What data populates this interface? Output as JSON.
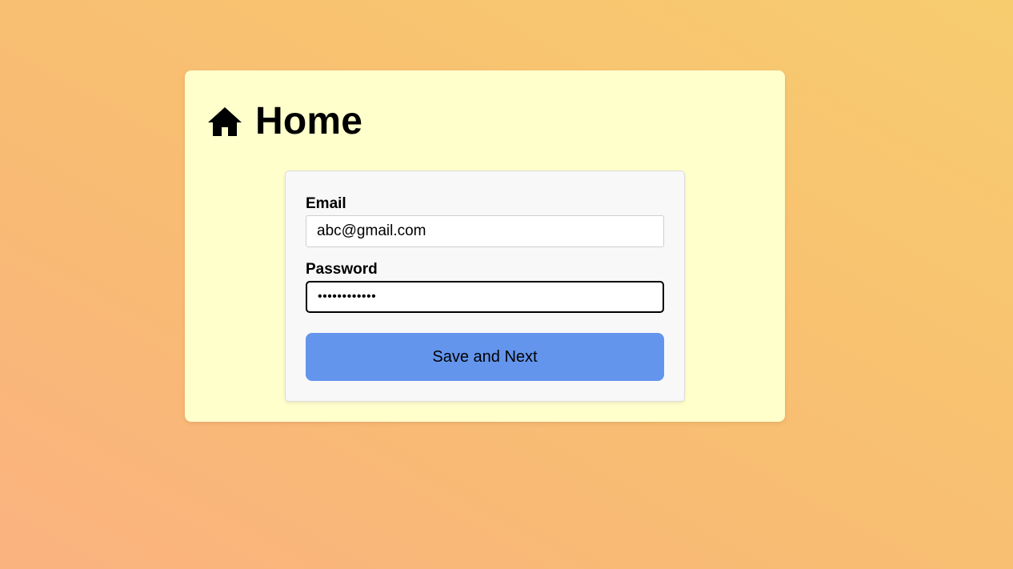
{
  "header": {
    "icon": "home-icon",
    "title": "Home"
  },
  "form": {
    "email_label": "Email",
    "email_value": "abc@gmail.com",
    "password_label": "Password",
    "password_value": "••••••••••••",
    "submit_label": "Save and Next"
  },
  "colors": {
    "card_background": "#ffffcc",
    "button_background": "#6495ed",
    "page_gradient_start": "#fab27f",
    "page_gradient_end": "#f7cc6f"
  }
}
